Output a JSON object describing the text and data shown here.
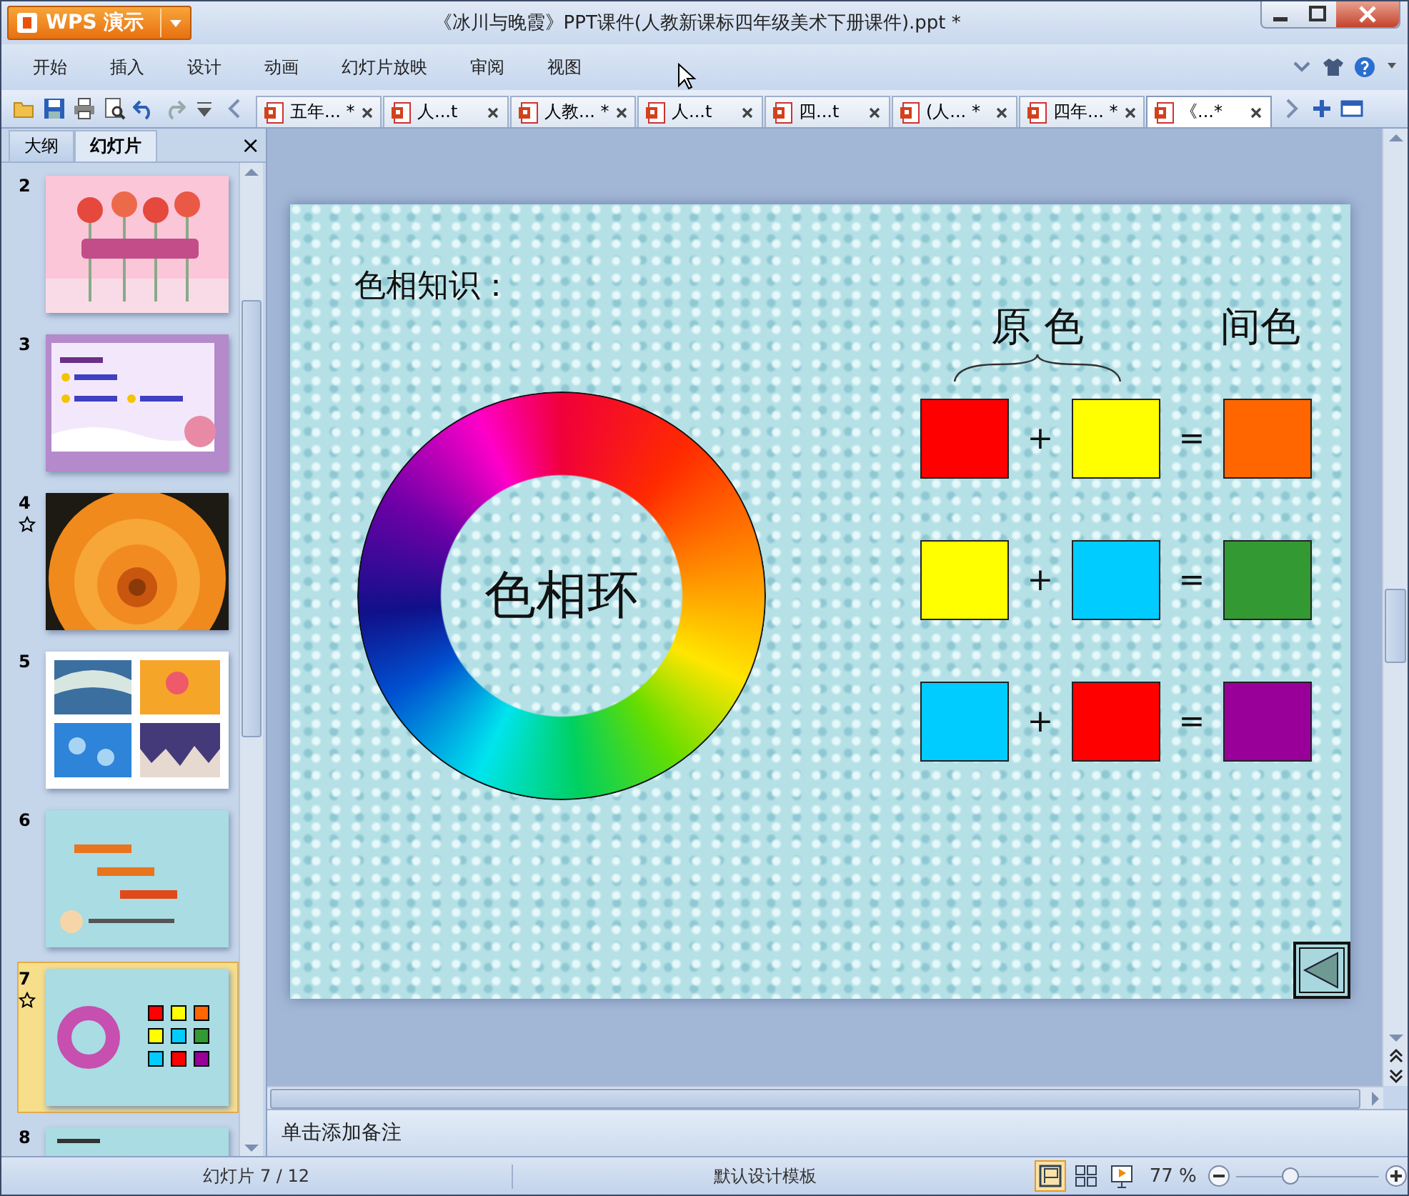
{
  "window": {
    "app_button": "WPS 演示",
    "title": "《冰川与晚霞》PPT课件(人教新课标四年级美术下册课件).ppt *"
  },
  "menu": {
    "items": [
      "开始",
      "插入",
      "设计",
      "动画",
      "幻灯片放映",
      "审阅",
      "视图"
    ]
  },
  "doc_tabs": [
    {
      "label": "五年... *",
      "selected": false
    },
    {
      "label": "人...t",
      "selected": false
    },
    {
      "label": "人教... *",
      "selected": false
    },
    {
      "label": "人...t",
      "selected": false
    },
    {
      "label": "四...t",
      "selected": false
    },
    {
      "label": "(人... *",
      "selected": false
    },
    {
      "label": "四年... *",
      "selected": false
    },
    {
      "label": "《...*",
      "selected": true
    }
  ],
  "side_panel": {
    "tabs": [
      {
        "label": "大纲",
        "selected": false
      },
      {
        "label": "幻灯片",
        "selected": true
      }
    ],
    "close": "×",
    "slides": [
      {
        "number": "2",
        "starred": false,
        "selected": false,
        "kind": "picture"
      },
      {
        "number": "3",
        "starred": false,
        "selected": false,
        "kind": "picture"
      },
      {
        "number": "4",
        "starred": true,
        "selected": false,
        "kind": "picture"
      },
      {
        "number": "5",
        "starred": false,
        "selected": false,
        "kind": "picture"
      },
      {
        "number": "6",
        "starred": false,
        "selected": false,
        "kind": "picture"
      },
      {
        "number": "7",
        "starred": true,
        "selected": true,
        "kind": "picture"
      },
      {
        "number": "8",
        "starred": false,
        "selected": false,
        "kind": "picture"
      }
    ]
  },
  "slide": {
    "heading": "色相知识：",
    "wheel_label": "色相环",
    "primary_header": "原 色",
    "secondary_header": "间色",
    "equations": [
      {
        "left": {
          "color": "#ff0000"
        },
        "plus": "+",
        "right": {
          "color": "#ffff00"
        },
        "equals": "=",
        "result": {
          "color": "#ff6600"
        }
      },
      {
        "left": {
          "color": "#ffff00"
        },
        "plus": "+",
        "right": {
          "color": "#00ccff"
        },
        "equals": "=",
        "result": {
          "color": "#339933"
        }
      },
      {
        "left": {
          "color": "#00ccff"
        },
        "plus": "+",
        "right": {
          "color": "#ff0000"
        },
        "equals": "=",
        "result": {
          "color": "#990099"
        }
      }
    ]
  },
  "notes": {
    "placeholder": "单击添加备注"
  },
  "status_bar": {
    "slide_count": "幻灯片 7 / 12",
    "template": "默认设计模板",
    "views": [
      {
        "selected": true
      },
      {
        "selected": false
      },
      {
        "selected": false
      }
    ],
    "zoom": "77 %",
    "zoom_slider": {
      "level": 0.38
    }
  }
}
